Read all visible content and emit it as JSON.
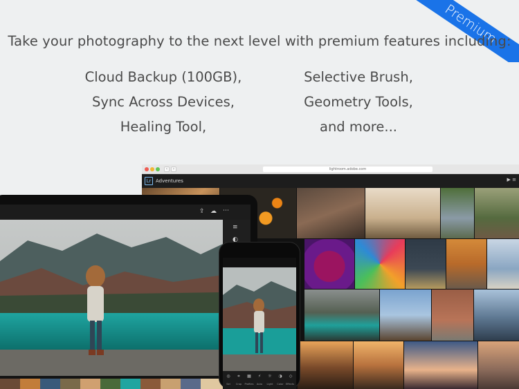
{
  "ribbon": {
    "label": "Premium",
    "color": "#1a73e8"
  },
  "headline": "Take your photography to the next level with premium features including:",
  "features_left": [
    "Cloud Backup (100GB),",
    "Sync Across Devices,",
    "Healing Tool,"
  ],
  "features_right": [
    "Selective Brush,",
    "Geometry Tools,",
    "and more..."
  ],
  "browser": {
    "url": "lightroom.adobe.com",
    "app_logo": "Lr",
    "album_title": "Adventures",
    "menu_icon": "play-icon"
  },
  "tablet": {
    "toolbar_icons": [
      "share-icon",
      "cloud-sync-icon",
      "more-icon"
    ],
    "side_icons": [
      "sliders-icon",
      "filter-icon"
    ]
  },
  "phone": {
    "tools": [
      {
        "icon": "selective-icon",
        "label": "Sel"
      },
      {
        "icon": "crop-icon",
        "label": "Crop"
      },
      {
        "icon": "profiles-icon",
        "label": "Profiles"
      },
      {
        "icon": "auto-icon",
        "label": "Auto"
      },
      {
        "icon": "light-icon",
        "label": "Light"
      },
      {
        "icon": "color-icon",
        "label": "Color"
      },
      {
        "icon": "effects-icon",
        "label": "Effects"
      }
    ]
  }
}
